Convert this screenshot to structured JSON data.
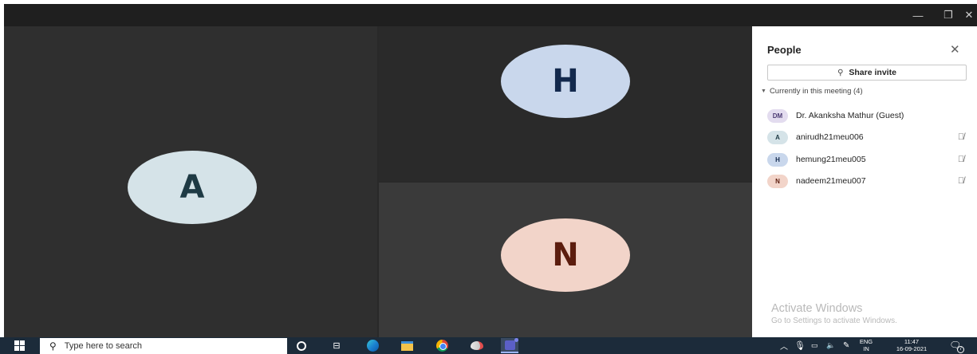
{
  "window": {
    "controls": {
      "minimize": "—",
      "maximize": "❐",
      "close": "✕"
    }
  },
  "stage": {
    "tiles": [
      {
        "initial": "A",
        "color": "#d5e3e8"
      },
      {
        "initial": "H",
        "color": "#c9d7ec"
      },
      {
        "initial": "N",
        "color": "#f2d4c9"
      }
    ]
  },
  "people_panel": {
    "title": "People",
    "close_icon": "close-icon",
    "share_invite_label": "Share invite",
    "section_label": "Currently in this meeting (4)",
    "participants": [
      {
        "initials": "DM",
        "name": "Dr. Akanksha Mathur (Guest)",
        "avatar_color": "#e3dcef",
        "muted": false
      },
      {
        "initials": "A",
        "name": "anirudh21meu006",
        "avatar_color": "#d5e3e8",
        "muted": true
      },
      {
        "initials": "H",
        "name": "hemung21meu005",
        "avatar_color": "#c9d7ec",
        "muted": true
      },
      {
        "initials": "N",
        "name": "nadeem21meu007",
        "avatar_color": "#f2d4c9",
        "muted": true
      }
    ],
    "watermark": {
      "title": "Activate Windows",
      "subtitle": "Go to Settings to activate Windows."
    }
  },
  "taskbar": {
    "search_placeholder": "Type here to search",
    "pinned_apps": [
      "cortana-icon",
      "task-view-icon",
      "edge-icon",
      "file-explorer-icon",
      "chrome-icon",
      "paint-icon",
      "teams-icon"
    ],
    "tray": {
      "language_line1": "ENG",
      "language_line2": "IN",
      "time": "11:47",
      "date": "16-09-2021",
      "notification_count": "7"
    }
  }
}
